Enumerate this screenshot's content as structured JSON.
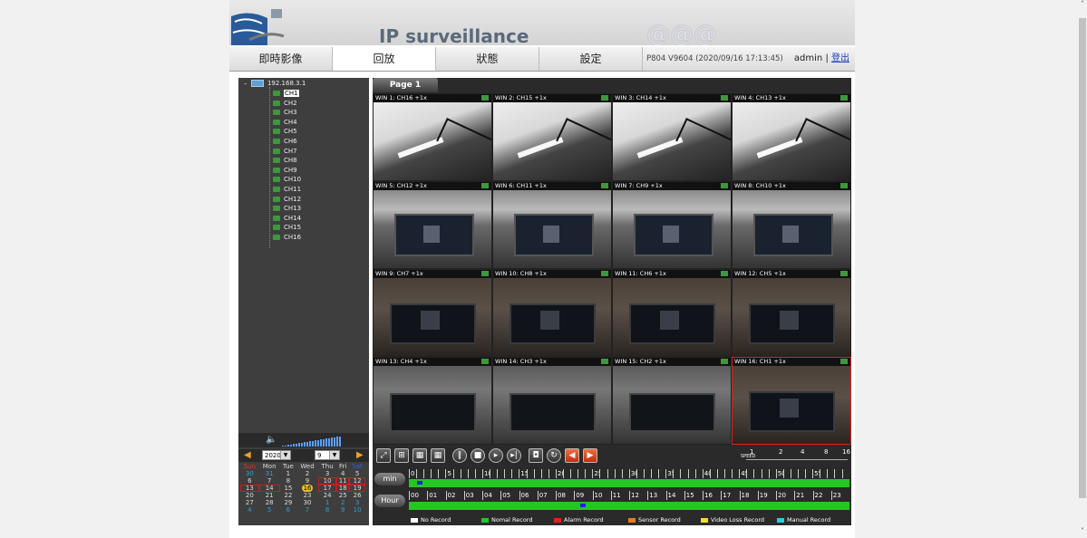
{
  "banner": {
    "title": "IP surveillance"
  },
  "nav": {
    "tabs": [
      {
        "label": "即時影像"
      },
      {
        "label": "回放"
      },
      {
        "label": "狀態"
      },
      {
        "label": "設定"
      }
    ],
    "version": "P804 V9604 (2020/09/16 17:13:45)",
    "user": "admin",
    "separator": "|",
    "logout": "登出"
  },
  "tree": {
    "root": "192.168.3.1",
    "channels": [
      "CH1",
      "CH2",
      "CH3",
      "CH4",
      "CH5",
      "CH6",
      "CH7",
      "CH8",
      "CH9",
      "CH10",
      "CH11",
      "CH12",
      "CH13",
      "CH14",
      "CH15",
      "CH16"
    ],
    "selected": "CH1"
  },
  "date": {
    "year": "2020",
    "month": "9"
  },
  "calendar": {
    "days": [
      "Sun",
      "Mon",
      "Tue",
      "Wed",
      "Thu",
      "Fri",
      "Sat"
    ],
    "weeks": [
      [
        "30",
        "31",
        "1",
        "2",
        "3",
        "4",
        "5"
      ],
      [
        "6",
        "7",
        "8",
        "9",
        "10",
        "11",
        "12"
      ],
      [
        "13",
        "14",
        "15",
        "16",
        "17",
        "18",
        "19"
      ],
      [
        "20",
        "21",
        "22",
        "23",
        "24",
        "25",
        "26"
      ],
      [
        "27",
        "28",
        "29",
        "30",
        "1",
        "2",
        "3"
      ],
      [
        "4",
        "5",
        "6",
        "7",
        "8",
        "9",
        "10"
      ]
    ],
    "today": "16"
  },
  "playback": {
    "page_label": "Page 1",
    "windows": [
      "WIN 1: CH16 +1x",
      "WIN 2: CH15 +1x",
      "WIN 3: CH14 +1x",
      "WIN 4: CH13 +1x",
      "WIN 5: CH12 +1x",
      "WIN 6: CH11 +1x",
      "WIN 7: CH9 +1x",
      "WIN 8: CH10 +1x",
      "WIN 9: CH7 +1x",
      "WIN 10: CH8 +1x",
      "WIN 11: CH6 +1x",
      "WIN 12: CH5 +1x",
      "WIN 13: CH4 +1x",
      "WIN 14: CH3 +1x",
      "WIN 15: CH2 +1x",
      "WIN 16: CH1 +1x"
    ],
    "selected_window": "WIN 16: CH1 +1x",
    "speed_label": "SPEED",
    "speeds": [
      "1",
      "2",
      "4",
      "8",
      "16"
    ]
  },
  "timeline": {
    "min_label": "min",
    "hour_label": "Hour",
    "min_ticks": [
      "0",
      "",
      "",
      "",
      "",
      "5",
      "",
      "",
      "",
      "",
      "10",
      "",
      "",
      "",
      "",
      "15",
      "",
      "",
      "",
      "",
      "20",
      "",
      "",
      "",
      "",
      "25",
      "",
      "",
      "",
      "",
      "30",
      "",
      "",
      "",
      "",
      "35",
      "",
      "",
      "",
      "",
      "40",
      "",
      "",
      "",
      "",
      "45",
      "",
      "",
      "",
      "",
      "50",
      "",
      "",
      "",
      "",
      "55",
      "",
      "",
      "",
      ""
    ],
    "hour_ticks": [
      "00",
      "01",
      "02",
      "03",
      "04",
      "05",
      "06",
      "07",
      "08",
      "09",
      "10",
      "11",
      "12",
      "13",
      "14",
      "15",
      "16",
      "17",
      "18",
      "19",
      "20",
      "21",
      "22",
      "23"
    ],
    "current_min": 1,
    "current_hour": 9
  },
  "legend": [
    {
      "label": "No Record",
      "color": "#ffffff"
    },
    {
      "label": "Nomal Record",
      "color": "#22c822"
    },
    {
      "label": "Alarm Record",
      "color": "#e02020"
    },
    {
      "label": "Sensor Record",
      "color": "#e08020"
    },
    {
      "label": "Video Loss Record",
      "color": "#f0e020"
    },
    {
      "label": "Manual Record",
      "color": "#20d0e0"
    }
  ]
}
